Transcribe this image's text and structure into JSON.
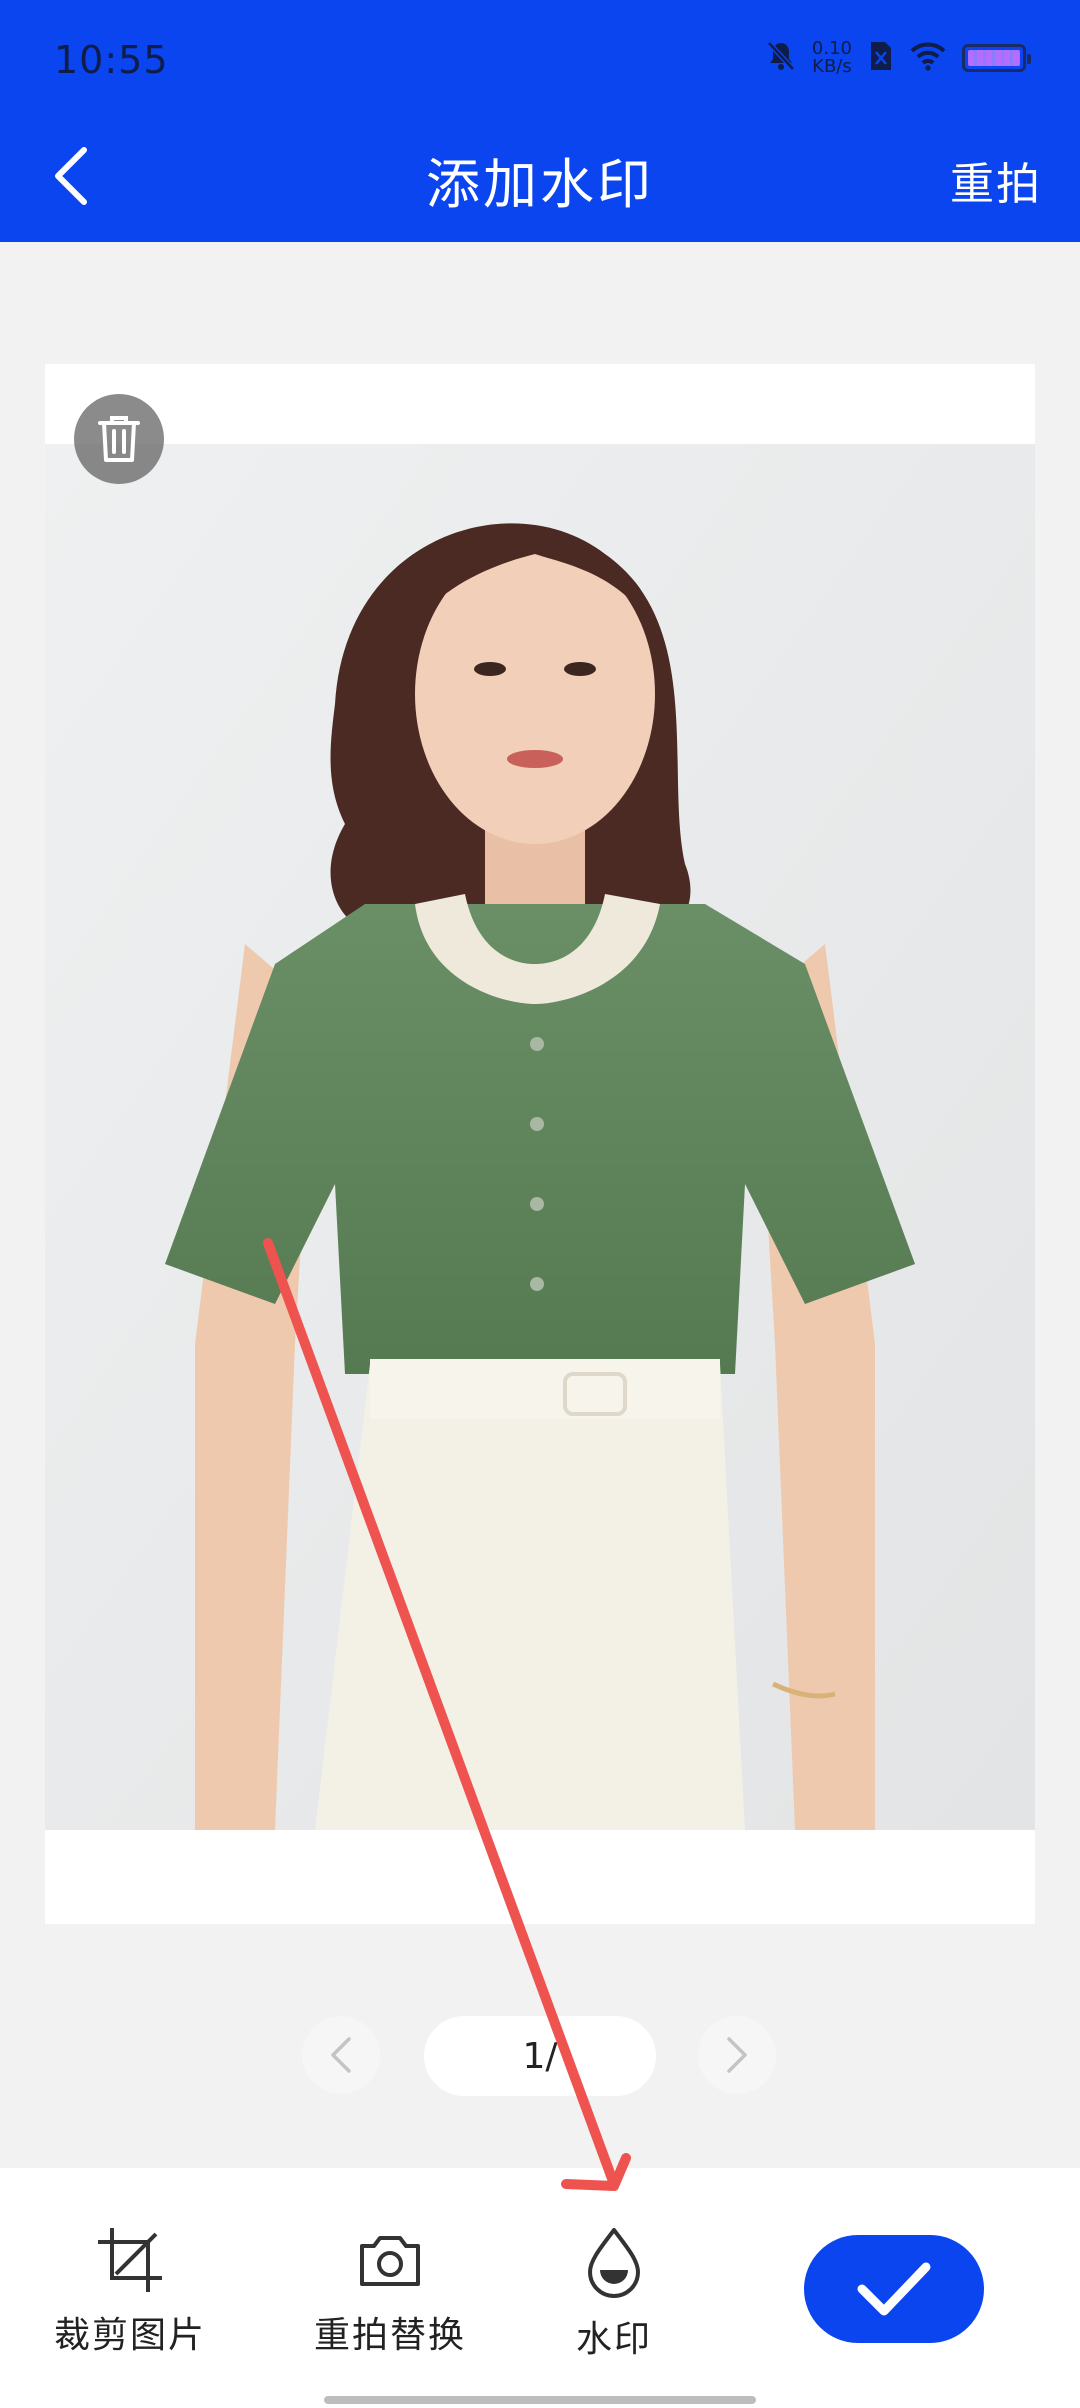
{
  "status_bar": {
    "time": "10:55",
    "net_speed_value": "0.10",
    "net_speed_unit": "KB/s"
  },
  "header": {
    "title": "添加水印",
    "retake_label": "重拍"
  },
  "pager": {
    "count": "1/"
  },
  "toolbar": {
    "crop_label": "裁剪图片",
    "retake_replace_label": "重拍替换",
    "watermark_label": "水印"
  },
  "colors": {
    "accent": "#0a45f0",
    "annotation_arrow": "#ef5350"
  }
}
